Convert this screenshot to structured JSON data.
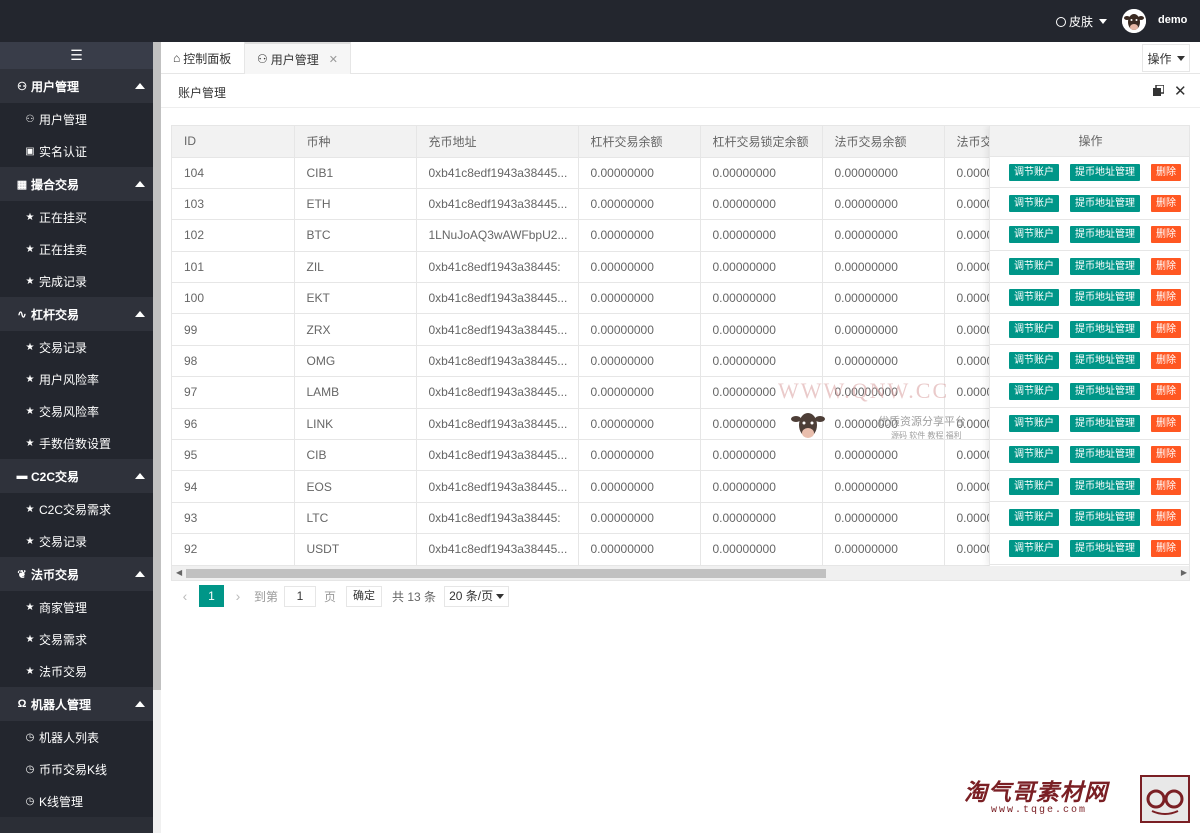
{
  "header": {
    "skin_label": "皮肤",
    "username": "demo"
  },
  "sidebar": {
    "groups": [
      {
        "label": "用户管理",
        "icon": "user-icon",
        "items": [
          {
            "label": "用户管理",
            "icon": "user-icon"
          },
          {
            "label": "实名认证",
            "icon": "camera-icon"
          }
        ]
      },
      {
        "label": "撮合交易",
        "icon": "grid-icon",
        "items": [
          {
            "label": "正在挂买",
            "icon": "star-icon"
          },
          {
            "label": "正在挂卖",
            "icon": "star-icon"
          },
          {
            "label": "完成记录",
            "icon": "star-icon"
          }
        ]
      },
      {
        "label": "杠杆交易",
        "icon": "pulse-icon",
        "items": [
          {
            "label": "交易记录",
            "icon": "star-icon"
          },
          {
            "label": "用户风险率",
            "icon": "star-icon"
          },
          {
            "label": "交易风险率",
            "icon": "star-icon"
          },
          {
            "label": "手数倍数设置",
            "icon": "star-icon"
          }
        ]
      },
      {
        "label": "C2C交易",
        "icon": "monitor-icon",
        "items": [
          {
            "label": "C2C交易需求",
            "icon": "star-icon"
          },
          {
            "label": "交易记录",
            "icon": "star-icon"
          }
        ]
      },
      {
        "label": "法币交易",
        "icon": "leaf-icon",
        "items": [
          {
            "label": "商家管理",
            "icon": "star-icon"
          },
          {
            "label": "交易需求",
            "icon": "star-icon"
          },
          {
            "label": "法币交易",
            "icon": "star-icon"
          }
        ]
      },
      {
        "label": "机器人管理",
        "icon": "headset-icon",
        "items": [
          {
            "label": "机器人列表",
            "icon": "clock-icon"
          },
          {
            "label": "币币交易K线",
            "icon": "clock-icon"
          },
          {
            "label": "K线管理",
            "icon": "clock-icon"
          }
        ]
      }
    ]
  },
  "tabs": [
    {
      "label": "控制面板",
      "icon": "home-icon"
    },
    {
      "label": "用户管理",
      "icon": "user-icon"
    }
  ],
  "ops_label": "操作",
  "panel": {
    "title": "账户管理"
  },
  "table": {
    "columns": [
      "ID",
      "币种",
      "充币地址",
      "杠杆交易余额",
      "杠杆交易锁定余额",
      "法币交易余额",
      "法币交"
    ],
    "ops_header": "操作",
    "rows": [
      [
        "104",
        "CIB1",
        "0xb41c8edf1943a38445...",
        "0.00000000",
        "0.00000000",
        "0.00000000",
        "0.0000"
      ],
      [
        "103",
        "ETH",
        "0xb41c8edf1943a38445...",
        "0.00000000",
        "0.00000000",
        "0.00000000",
        "0.0000"
      ],
      [
        "102",
        "BTC",
        "1LNuJoAQ3wAWFbpU2...",
        "0.00000000",
        "0.00000000",
        "0.00000000",
        "0.0000"
      ],
      [
        "101",
        "ZIL",
        "0xb41c8edf1943a38445:",
        "0.00000000",
        "0.00000000",
        "0.00000000",
        "0.0000"
      ],
      [
        "100",
        "EKT",
        "0xb41c8edf1943a38445...",
        "0.00000000",
        "0.00000000",
        "0.00000000",
        "0.0000"
      ],
      [
        "99",
        "ZRX",
        "0xb41c8edf1943a38445...",
        "0.00000000",
        "0.00000000",
        "0.00000000",
        "0.0000"
      ],
      [
        "98",
        "OMG",
        "0xb41c8edf1943a38445...",
        "0.00000000",
        "0.00000000",
        "0.00000000",
        "0.0000"
      ],
      [
        "97",
        "LAMB",
        "0xb41c8edf1943a38445...",
        "0.00000000",
        "0.00000000",
        "0.00000000",
        "0.0000"
      ],
      [
        "96",
        "LINK",
        "0xb41c8edf1943a38445...",
        "0.00000000",
        "0.00000000",
        "0.00000000",
        "0.0000"
      ],
      [
        "95",
        "CIB",
        "0xb41c8edf1943a38445...",
        "0.00000000",
        "0.00000000",
        "0.00000000",
        "0.0000"
      ],
      [
        "94",
        "EOS",
        "0xb41c8edf1943a38445...",
        "0.00000000",
        "0.00000000",
        "0.00000000",
        "0.0000"
      ],
      [
        "93",
        "LTC",
        "0xb41c8edf1943a38445:",
        "0.00000000",
        "0.00000000",
        "0.00000000",
        "0.0000"
      ],
      [
        "92",
        "USDT",
        "0xb41c8edf1943a38445...",
        "0.00000000",
        "0.00000000",
        "0.00000000",
        "0.0000"
      ]
    ],
    "row_actions": [
      "调节账户",
      "提币地址管理",
      "删除"
    ]
  },
  "pager": {
    "current": "1",
    "goto_label": "到第",
    "goto_value": "1",
    "page_unit": "页",
    "confirm": "确定",
    "total": "共 13 条",
    "page_size": "20 条/页"
  },
  "watermark": {
    "url": "WWW.QNW.CC",
    "name": "优质资源分享平台",
    "tags": "源码 软件 教程 福利",
    "brand": "淘气哥素材网",
    "brand_url": "www.tqge.com"
  },
  "colors": {
    "header_bg": "#23262e",
    "accent": "#009688",
    "danger": "#ff5722"
  }
}
